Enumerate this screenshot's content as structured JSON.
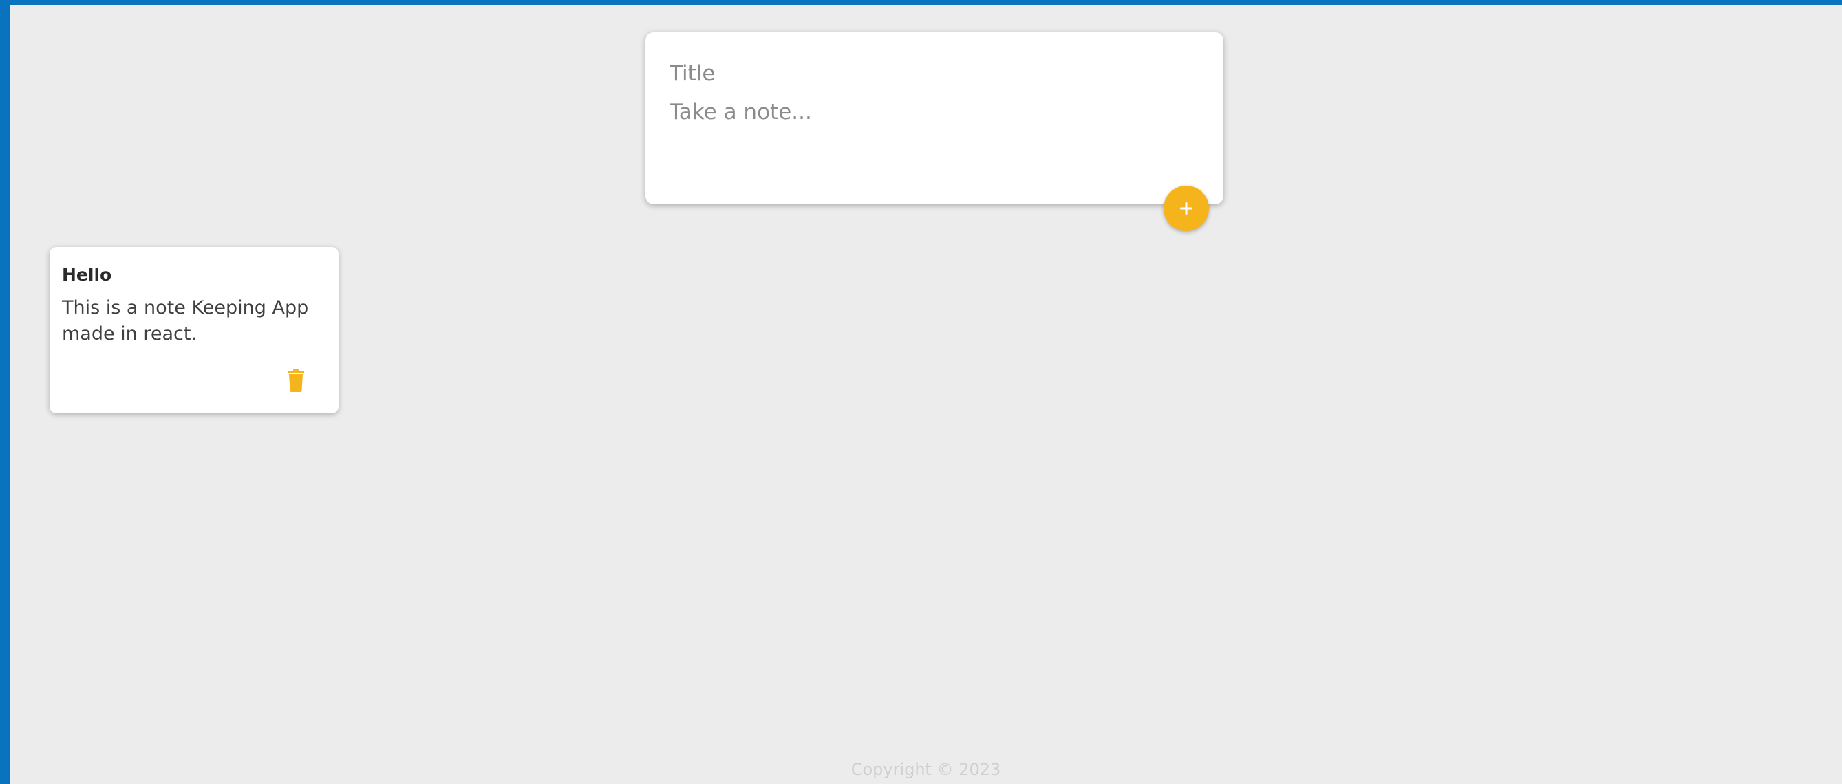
{
  "create_area": {
    "title_placeholder": "Title",
    "content_placeholder": "Take a note..."
  },
  "add_button": {
    "icon": "plus-icon"
  },
  "notes": [
    {
      "title": "Hello",
      "content": "This is a note Keeping App made in react.",
      "delete_icon": "trash-icon"
    }
  ],
  "footer": {
    "text": "Copyright © 2023"
  },
  "colors": {
    "window_border": "#0a73bf",
    "background": "#ececec",
    "accent": "#f5b41c",
    "card": "#ffffff"
  }
}
